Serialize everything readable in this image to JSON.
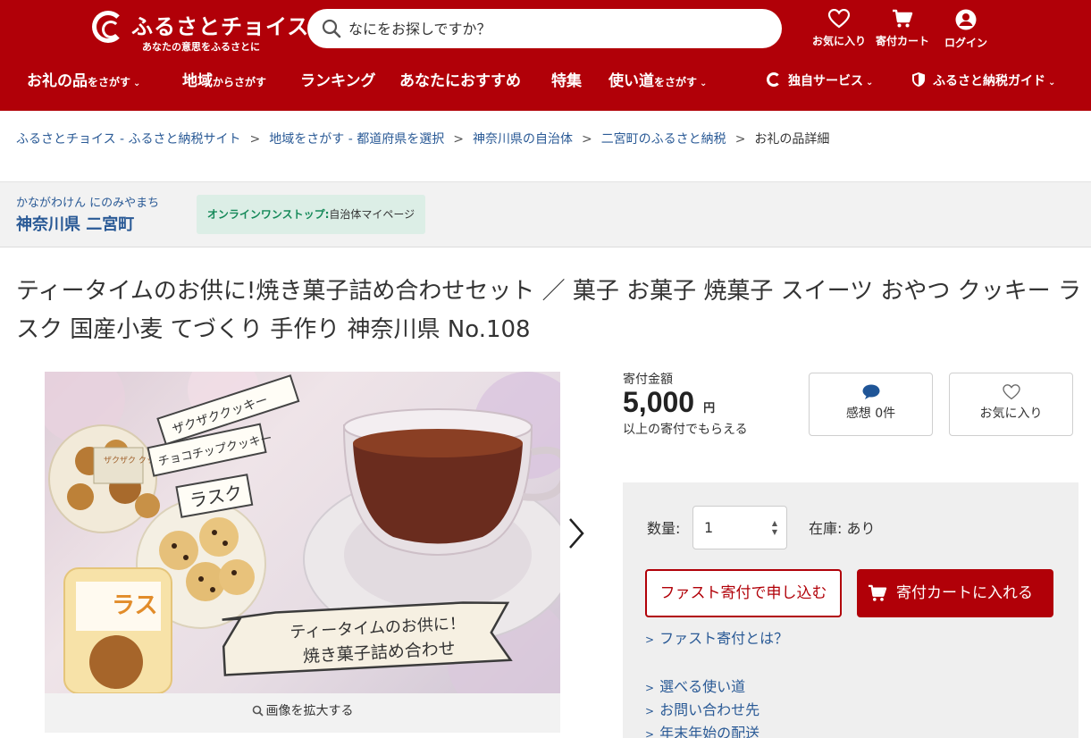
{
  "header": {
    "logo_text": "ふるさとチョイス",
    "logo_tagline": "あなたの意思をふるさとに",
    "search_placeholder": "なにをお探しですか？",
    "favorites_label": "お気に入り",
    "cart_label": "寄付カート",
    "login_label": "ログイン"
  },
  "nav": {
    "gift_main": "お礼の品",
    "gift_sub": "をさがす",
    "region_main": "地域",
    "region_sub": "からさがす",
    "ranking": "ランキング",
    "recommend": "あなたにおすすめ",
    "special": "特集",
    "usage_main": "使い道",
    "usage_sub": "をさがす",
    "services": "独自サービス",
    "guide": "ふるさと納税ガイド"
  },
  "breadcrumb": {
    "items": [
      "ふるさとチョイス - ふるさと納税サイト",
      "地域をさがす - 都道府県を選択",
      "神奈川県の自治体",
      "二宮町のふるさと納税"
    ],
    "current": "お礼の品詳細",
    "separator": ">"
  },
  "municipality": {
    "kana": "かながわけん にのみやまち",
    "name": "神奈川県 二宮町",
    "onestop_label": "オンラインワンストップ:",
    "onestop_link": "自治体マイページ"
  },
  "product": {
    "title": "ティータイムのお供に!焼き菓子詰め合わせセット ／ 菓子 お菓子 焼菓子 スイーツ おやつ クッキー ラスク 国産小麦 てづくり 手作り 神奈川県 No.108",
    "image_caption": "画像を拡大する",
    "image_texts": {
      "tag1": "ザクザククッキー",
      "tag2": "チョコチップクッキー",
      "tag3": "ラスク",
      "package1": "ザクザク クッキー",
      "package2": "ラス",
      "banner_line1": "ティータイムのお供に！",
      "banner_line2": "焼き菓子詰め合わせ"
    }
  },
  "donation": {
    "label": "寄付金額",
    "amount": "5,000",
    "currency": "円",
    "note": "以上の寄付でもらえる",
    "impressions_label": "感想 0件",
    "favorite_label": "お気に入り",
    "qty_label": "数量:",
    "qty_value": "1",
    "stock_label": "在庫: あり",
    "fast_button": "ファスト寄付で申し込む",
    "cart_button": "寄付カートに入れる",
    "links": [
      "ファスト寄付とは？",
      "選べる使い道",
      "お問い合わせ先",
      "年末年始の配送"
    ]
  },
  "colors": {
    "brand_red": "#b10008",
    "link_blue": "#2a5a96",
    "onestop_bg": "#dceee6",
    "onestop_green": "#178a5a"
  },
  "icons": {
    "search": "magnifier",
    "favorite": "heart-outline",
    "cart": "shopping-cart",
    "login": "user-circle",
    "impressions": "speech-bubble",
    "next": "chevron-right",
    "zoom": "magnifier"
  }
}
